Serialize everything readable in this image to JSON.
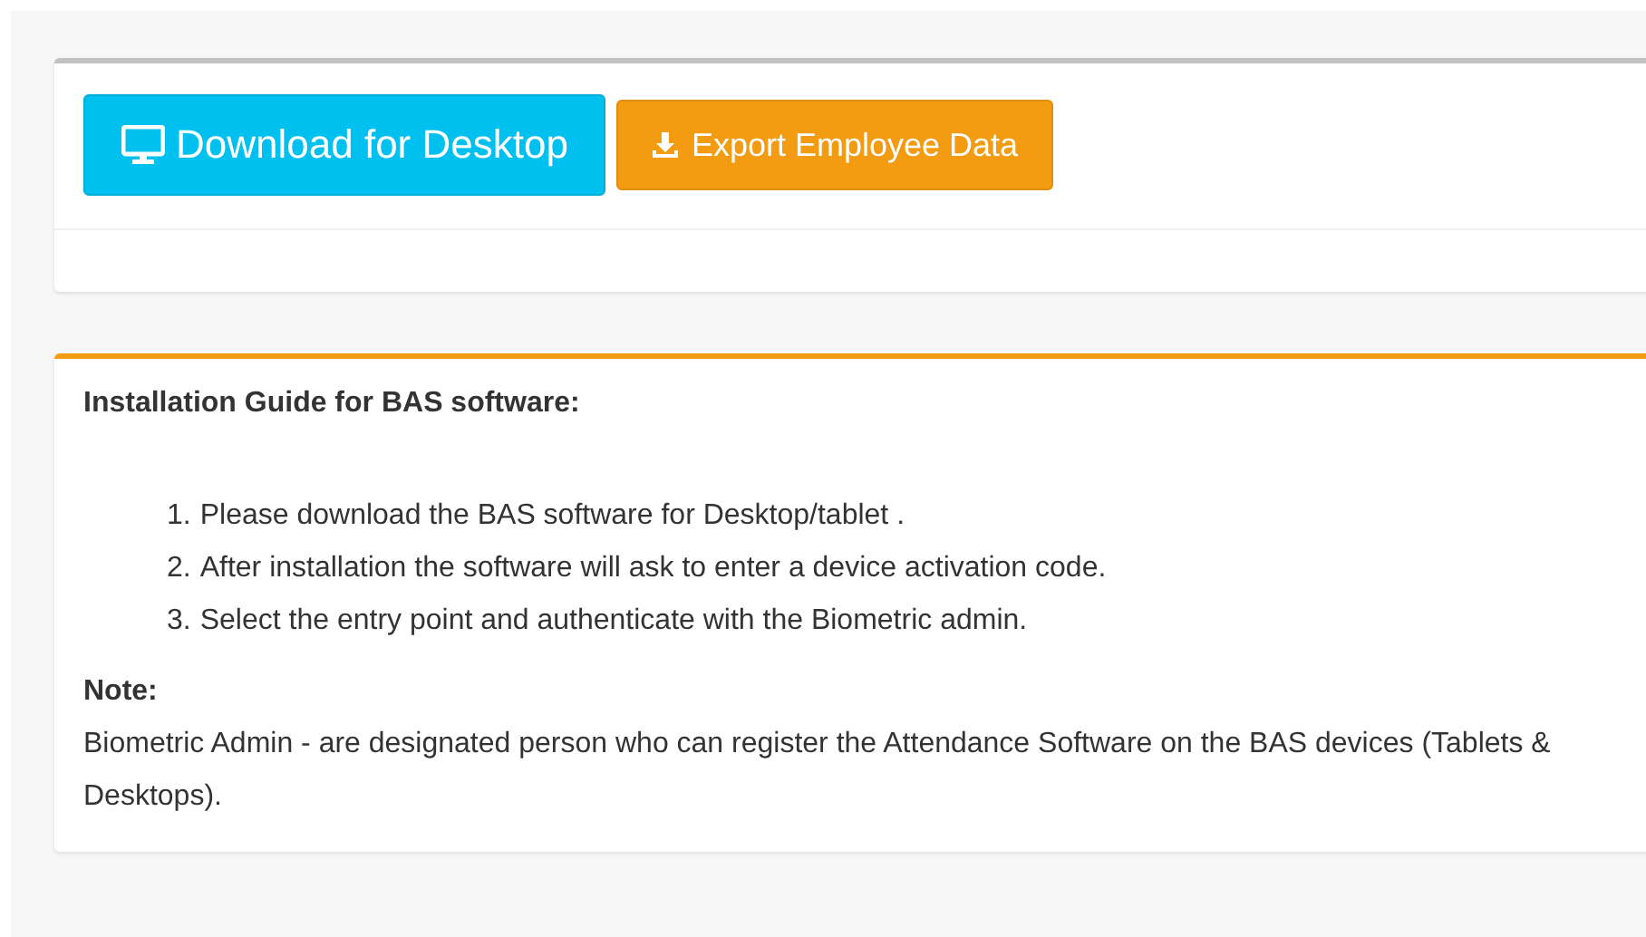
{
  "actions": [
    {
      "kind": "desktop",
      "label": "Download for Desktop"
    },
    {
      "kind": "export",
      "label": "Export Employee Data"
    }
  ],
  "guide": {
    "title": "Installation Guide for BAS software:",
    "steps": [
      {
        "number": "1.",
        "text": "Please download the BAS software for Desktop/tablet ."
      },
      {
        "number": "2.",
        "text": "After installation the software will ask to enter a device activation code."
      },
      {
        "number": "3.",
        "text": "Select the entry point and authenticate with the Biometric admin."
      }
    ],
    "note_label": "Note:",
    "note_text": "Biometric Admin - are designated person who can register the Attendance Software on the BAS devices (Tablets & Desktops)."
  }
}
